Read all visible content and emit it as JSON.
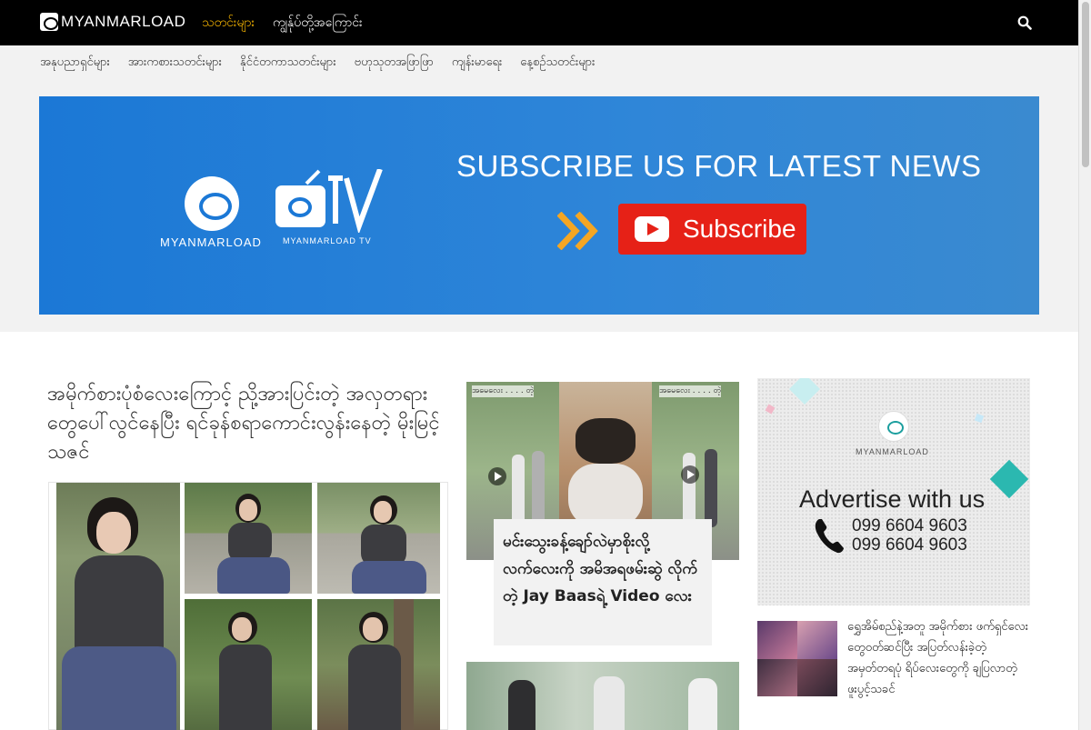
{
  "header": {
    "logo_text": "MYANMARLOAD",
    "nav": [
      {
        "label": "သတင်းများ",
        "active": true
      },
      {
        "label": "ကျွန်ုပ်တို့အကြောင်း",
        "active": false
      }
    ],
    "search_icon": "search-icon"
  },
  "subnav": [
    "အနုပညာရှင်များ",
    "အားကစားသတင်းများ",
    "နိုင်ငံတကာသတင်းများ",
    "ဗဟုသုတအဖြာဖြာ",
    "ကျန်းမာရေး",
    "နေ့စဉ်သတင်းများ"
  ],
  "banner": {
    "logo1_text": "MYANMARLOAD",
    "logo2_text": "MYANMARLOAD TV",
    "headline": "SUBSCRIBE US FOR LATEST NEWS",
    "subscribe_label": "Subscribe",
    "colors": {
      "background": "#1b78d6",
      "button": "#e62117",
      "arrows": "#f5a623"
    }
  },
  "featured": {
    "title": "အမိုက်စားပုံစံလေးကြောင့် ညို့အားပြင်းတဲ့ အလှတရားတွေပေါ်လွင်နေပြီး ရင်ခုန်စရာကောင်းလွန်းနေတဲ့ မိုးမြင့်သဇင်"
  },
  "middle": {
    "card_title": "မင်းသွေးခန့်ချော်လဲမှာစိုးလို့ လက်လေးကို အမိအရဖမ်းဆွဲ လိုက်တဲ့ Jay Baasရဲ့ Video လေး",
    "overlay_label_1": "အမေလေး . . . . တဲ့",
    "overlay_label_2": "အမေလေး . . . . တဲ့"
  },
  "ad": {
    "logo_text": "MYANMARLOAD",
    "title": "Advertise with us",
    "phone_1": "099 6604 9603",
    "phone_2": "099 6604 9603"
  },
  "sidebar_post": {
    "title": "ရွှေအိမ်စည်နဲ့အတူ အမိုက်စား ဖက်ရှင်လေးတွေဝတ်ဆင်ပြီး အပြတ်လန်းခဲ့တဲ့ အမှတ်တရပုံ ရိပ်လေးတွေကို ချပြလာတဲ့ ဖူးပွင့်သခင်"
  }
}
